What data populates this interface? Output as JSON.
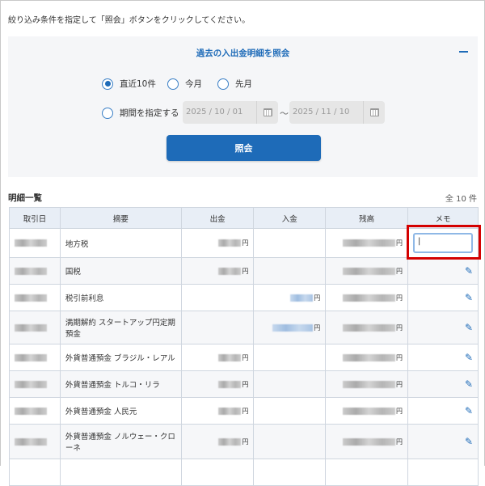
{
  "intro": "絞り込み条件を指定して「照会」ボタンをクリックしてください。",
  "panel": {
    "title": "過去の入出金明細を照会",
    "collapse_icon": "minus-icon",
    "radios": [
      {
        "label": "直近10件",
        "checked": true
      },
      {
        "label": "今月",
        "checked": false
      },
      {
        "label": "先月",
        "checked": false
      },
      {
        "label": "期間を指定する",
        "checked": false
      }
    ],
    "date_from": "2025 / 10 / 01",
    "date_to": "2025 / 11 / 10",
    "tilde": "～",
    "submit": "照会"
  },
  "list": {
    "title": "明細一覧",
    "count": "全 10 件",
    "headers": [
      "取引日",
      "摘要",
      "出金",
      "入金",
      "残高",
      "メモ"
    ],
    "yen": "円",
    "rows": [
      {
        "desc": "地方税",
        "type": "out"
      },
      {
        "desc": "国税",
        "type": "out"
      },
      {
        "desc": "税引前利息",
        "type": "in"
      },
      {
        "desc": "満期解約 スタートアップ円定期預金",
        "type": "in"
      },
      {
        "desc": "外貨普通預金 ブラジル・レアル",
        "type": "out"
      },
      {
        "desc": "外貨普通預金 トルコ・リラ",
        "type": "out"
      },
      {
        "desc": "外貨普通預金 人民元",
        "type": "out"
      },
      {
        "desc": "外貨普通預金 ノルウェー・クローネ",
        "type": "out"
      }
    ]
  },
  "colors": {
    "accent": "#1e6bb8",
    "highlight": "#d40000"
  }
}
